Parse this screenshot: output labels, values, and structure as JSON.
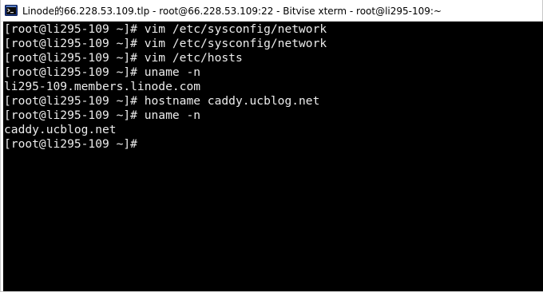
{
  "window": {
    "title": "Linode的66.228.53.109.tlp - root@66.228.53.109:22 - Bitvise xterm - root@li295-109:~",
    "icon": "bitvise-terminal-icon"
  },
  "terminal": {
    "background": "#000000",
    "foreground": "#ececec",
    "lines": [
      "[root@li295-109 ~]# vim /etc/sysconfig/network",
      "[root@li295-109 ~]# vim /etc/sysconfig/network",
      "[root@li295-109 ~]# vim /etc/hosts",
      "[root@li295-109 ~]# uname -n",
      "li295-109.members.linode.com",
      "[root@li295-109 ~]# hostname caddy.ucblog.net",
      "[root@li295-109 ~]# uname -n",
      "caddy.ucblog.net",
      "[root@li295-109 ~]#"
    ]
  }
}
